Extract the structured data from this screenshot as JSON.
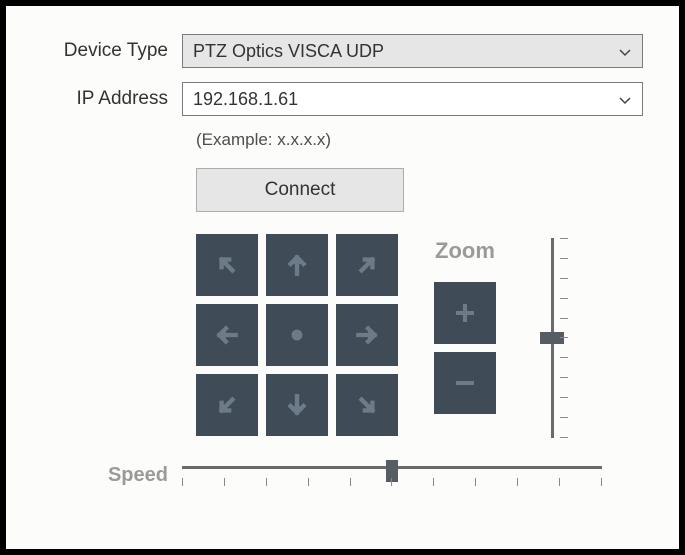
{
  "labels": {
    "device_type": "Device Type",
    "ip_address": "IP Address",
    "example": "(Example: x.x.x.x)",
    "connect": "Connect",
    "zoom": "Zoom",
    "speed": "Speed"
  },
  "fields": {
    "device_type_value": "PTZ Optics VISCA UDP",
    "ip_address_value": "192.168.1.61"
  },
  "icons": {
    "chevron_down": "chevron-down-icon",
    "up_left": "arrow-up-left-icon",
    "up": "arrow-up-icon",
    "up_right": "arrow-up-right-icon",
    "left": "arrow-left-icon",
    "center": "dot-icon",
    "right": "arrow-right-icon",
    "down_left": "arrow-down-left-icon",
    "down": "arrow-down-icon",
    "down_right": "arrow-down-right-icon",
    "plus": "plus-icon",
    "minus": "minus-icon"
  },
  "sliders": {
    "speed_value": 50,
    "zoom_value": 50
  },
  "colors": {
    "button_bg": "#3f4c58",
    "button_fg": "#6d7b88",
    "panel_bg": "#e6e6e6"
  }
}
